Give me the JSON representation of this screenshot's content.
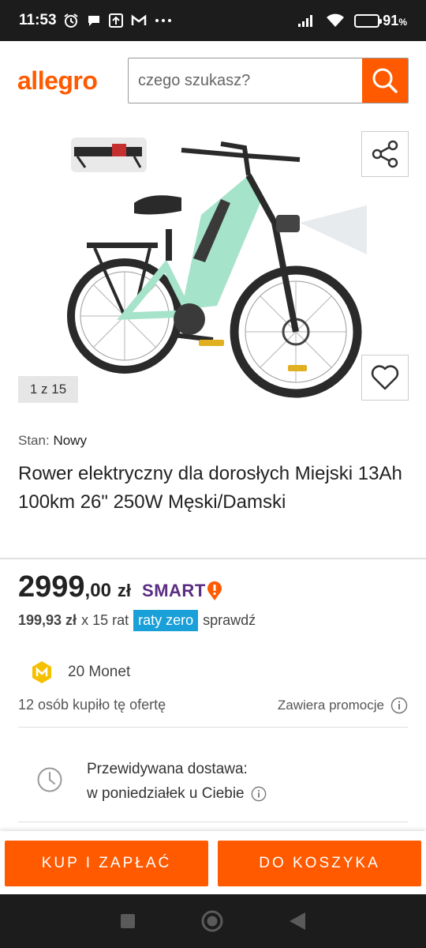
{
  "status_bar": {
    "time": "11:53",
    "battery_percent": 91,
    "battery_text": "91",
    "battery_unit": "%"
  },
  "header": {
    "logo": "allegro",
    "search_placeholder": "czego szukasz?"
  },
  "gallery": {
    "counter": "1 z 15",
    "product_image_icon": "electric-bike-icon",
    "thumbnail_icon": "rear-rack-light-icon"
  },
  "product": {
    "condition_label": "Stan:",
    "condition_value": "Nowy",
    "title": "Rower elektryczny dla dorosłych Miejski 13Ah 100km 26\" 250W Męski/Damski",
    "price_integer": "2999",
    "price_decimal": ",00",
    "price_currency": "zł",
    "smart_label": "SMART",
    "installment_amount": "199,93 zł",
    "installment_count_text": "x 15 rat",
    "installment_badge": "raty zero",
    "installment_link": "sprawdź",
    "coins_text": "20 Monet",
    "bought_text": "12 osób kupiło tę ofertę",
    "promo_text": "Zawiera promocje"
  },
  "delivery": {
    "label": "Przewidywana dostawa:",
    "date": "w poniedziałek u Ciebie"
  },
  "actions": {
    "buy_label": "KUP I ZAPŁAĆ",
    "cart_label": "DO KOSZYKA"
  },
  "colors": {
    "brand_orange": "#ff5a00",
    "smart_purple": "#5a2d82",
    "raty_blue": "#1aa0d8",
    "bike_mint": "#a6e3cb"
  }
}
